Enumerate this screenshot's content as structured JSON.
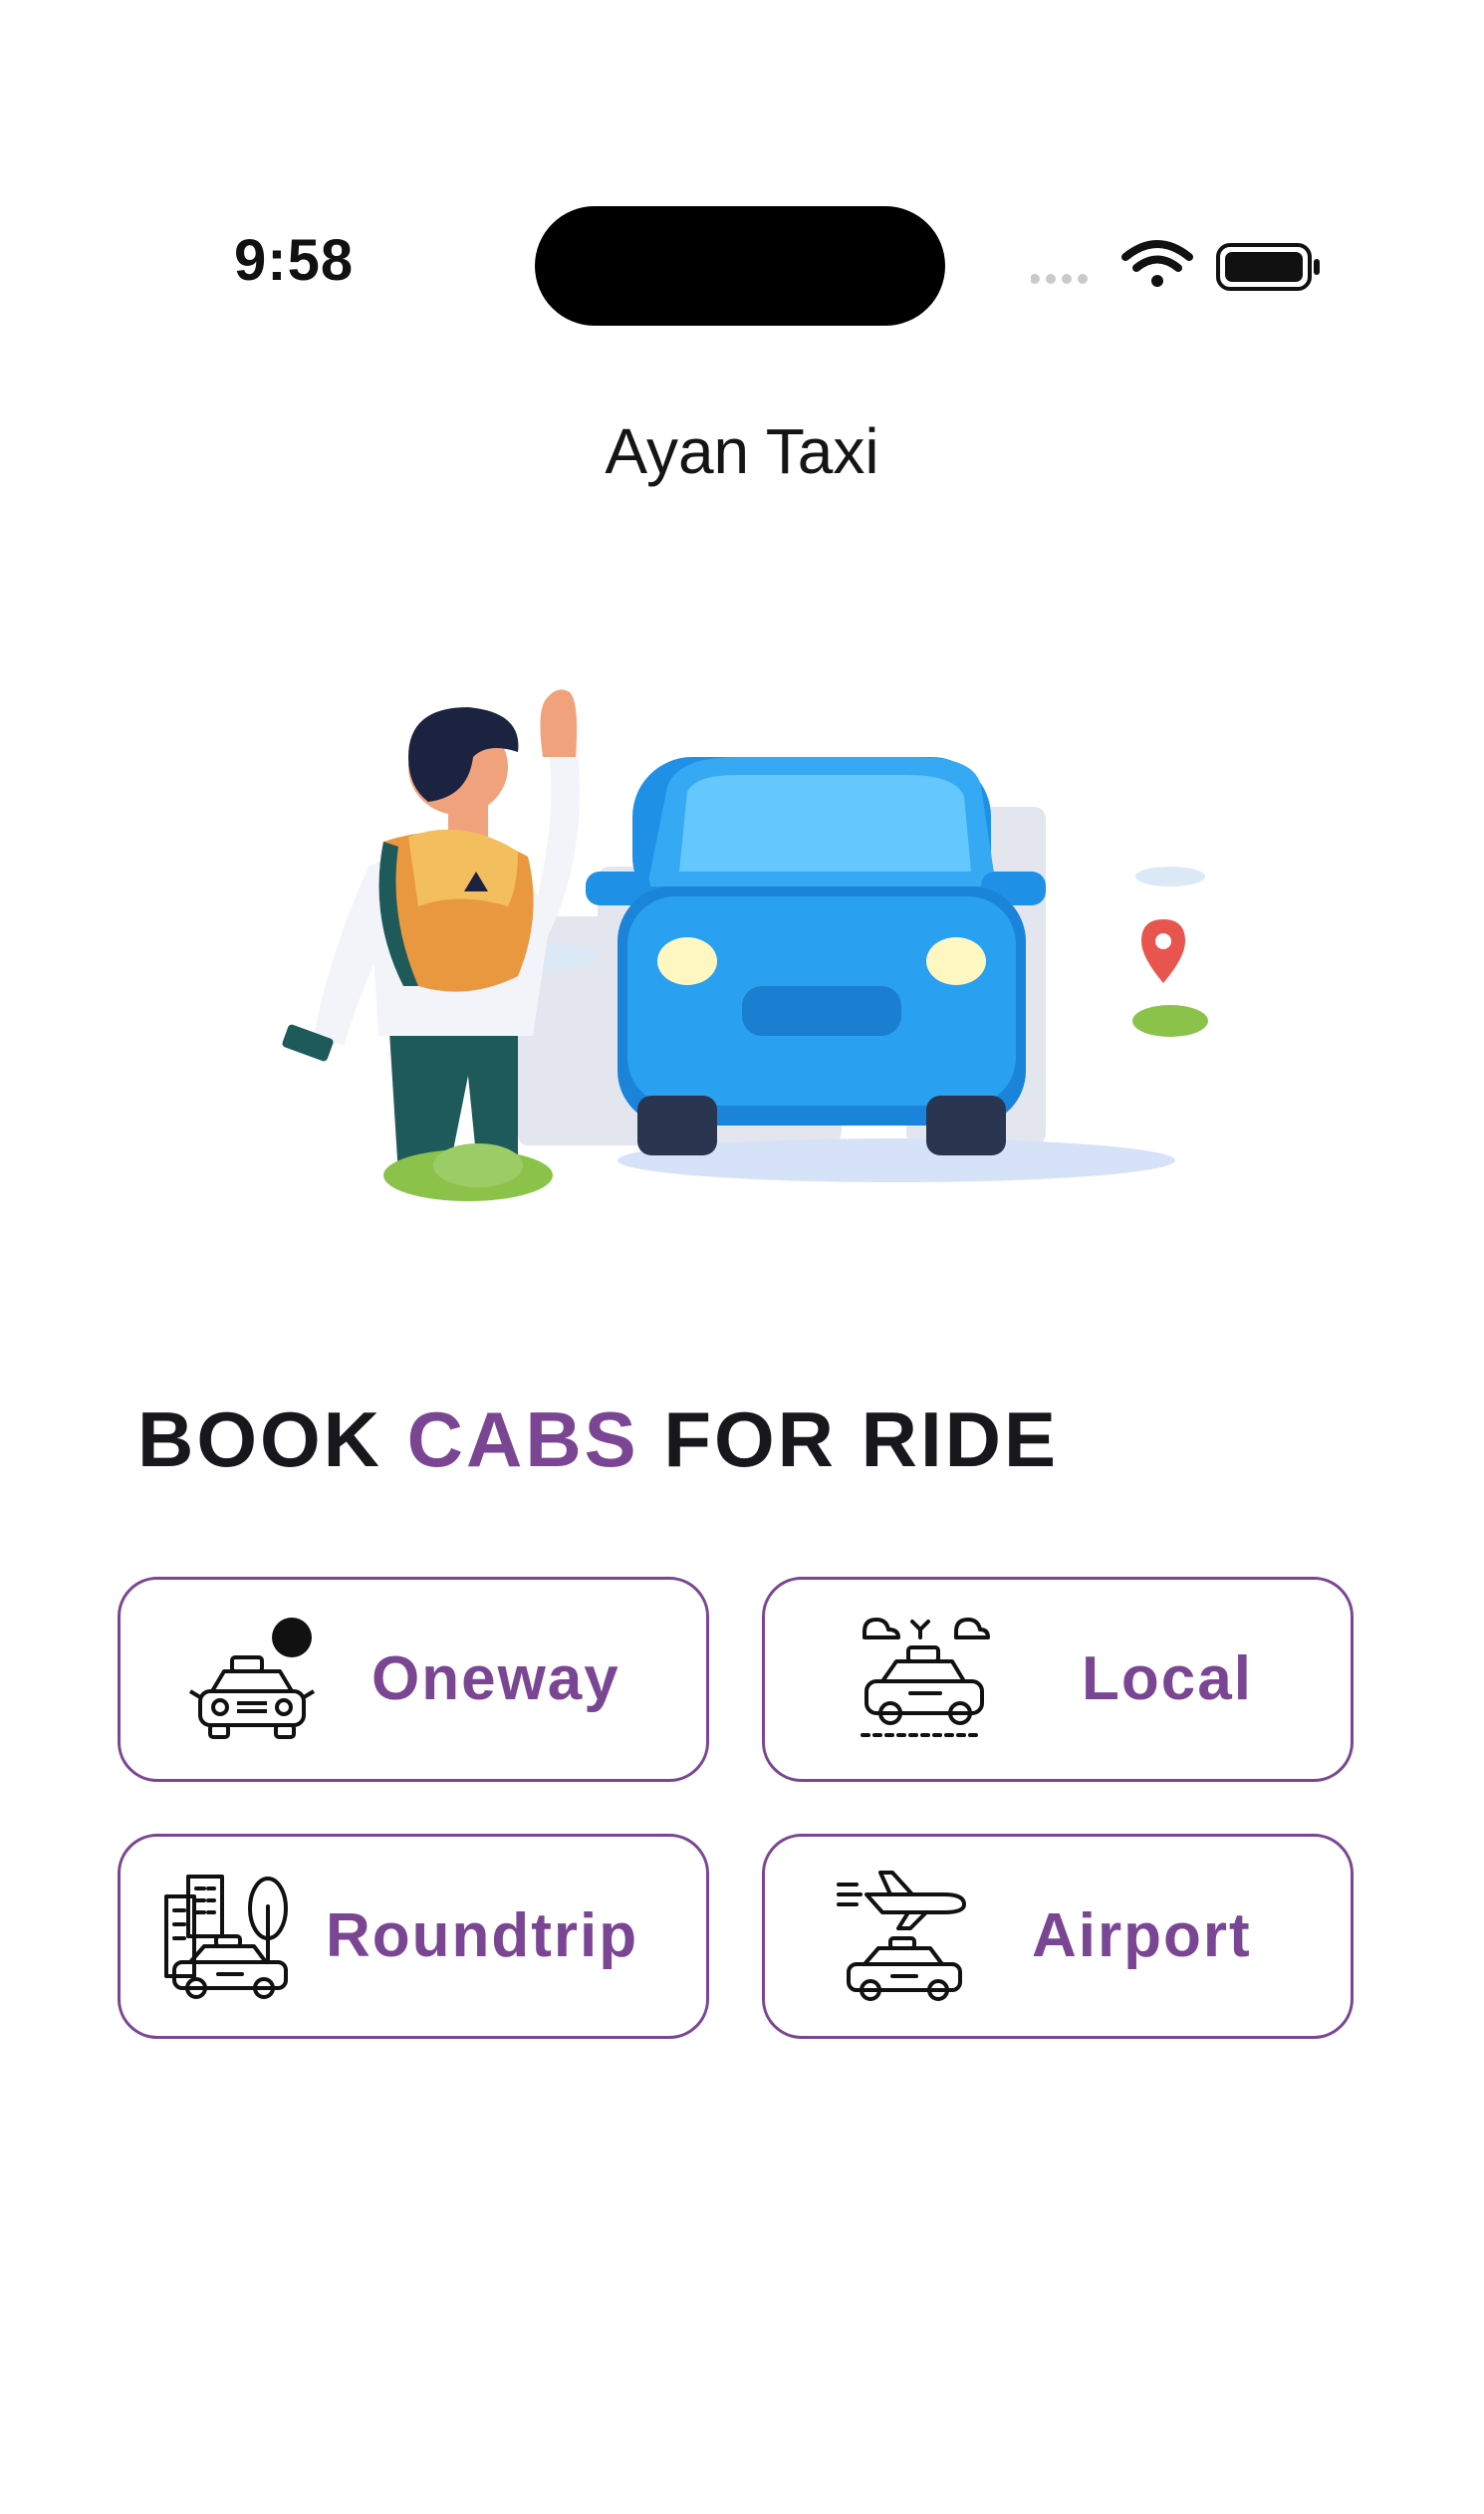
{
  "status_bar": {
    "time": "9:58"
  },
  "app": {
    "title": "Ayan Taxi"
  },
  "headline": {
    "part1": "BOOK ",
    "accent": "CABS",
    "part2": " FOR RIDE"
  },
  "colors": {
    "accent": "#7a4694",
    "car_blue": "#1e90e6"
  },
  "ride_options": [
    {
      "label": "Oneway",
      "icon": "oneway-taxi-icon"
    },
    {
      "label": "Local",
      "icon": "local-taxi-icon"
    },
    {
      "label": "Roundtrip",
      "icon": "roundtrip-city-taxi-icon"
    },
    {
      "label": "Airport",
      "icon": "airport-taxi-icon"
    }
  ]
}
